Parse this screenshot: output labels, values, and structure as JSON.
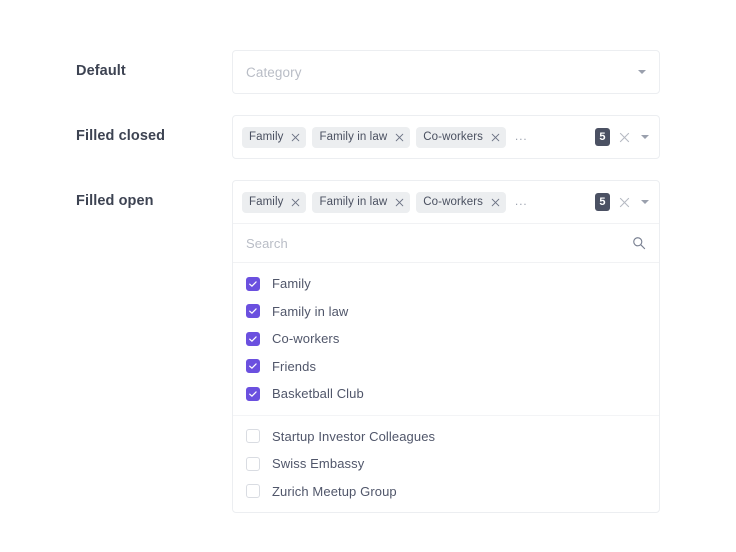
{
  "rows": [
    {
      "label": "Default"
    },
    {
      "label": "Filled closed"
    },
    {
      "label": "Filled open"
    }
  ],
  "default_field": {
    "placeholder": "Category",
    "caret_icon": "caret-down-icon"
  },
  "tokens": {
    "chips": [
      {
        "label": "Family",
        "remove_icon": "close-icon"
      },
      {
        "label": "Family in law",
        "remove_icon": "close-icon"
      },
      {
        "label": "Co-workers",
        "remove_icon": "close-icon"
      }
    ],
    "overflow_indicator": "...",
    "count_badge": "5",
    "clear_icon": "close-icon",
    "caret_icon": "caret-down-icon"
  },
  "search": {
    "placeholder": "Search",
    "icon": "search-icon"
  },
  "options": {
    "selected": [
      {
        "label": "Family",
        "checked": true
      },
      {
        "label": "Family in law",
        "checked": true
      },
      {
        "label": "Co-workers",
        "checked": true
      },
      {
        "label": "Friends",
        "checked": true
      },
      {
        "label": "Basketball Club",
        "checked": true
      }
    ],
    "unselected": [
      {
        "label": "Startup Investor Colleagues",
        "checked": false
      },
      {
        "label": "Swiss Embassy",
        "checked": false
      },
      {
        "label": "Zurich Meetup Group",
        "checked": false
      }
    ]
  },
  "colors": {
    "checkbox_checked": "#6b50df",
    "badge_background": "#4b5163",
    "chip_background": "#eceef0",
    "border": "#eceef1",
    "label_text": "#3d4352",
    "placeholder_text": "#b9bdc6"
  }
}
